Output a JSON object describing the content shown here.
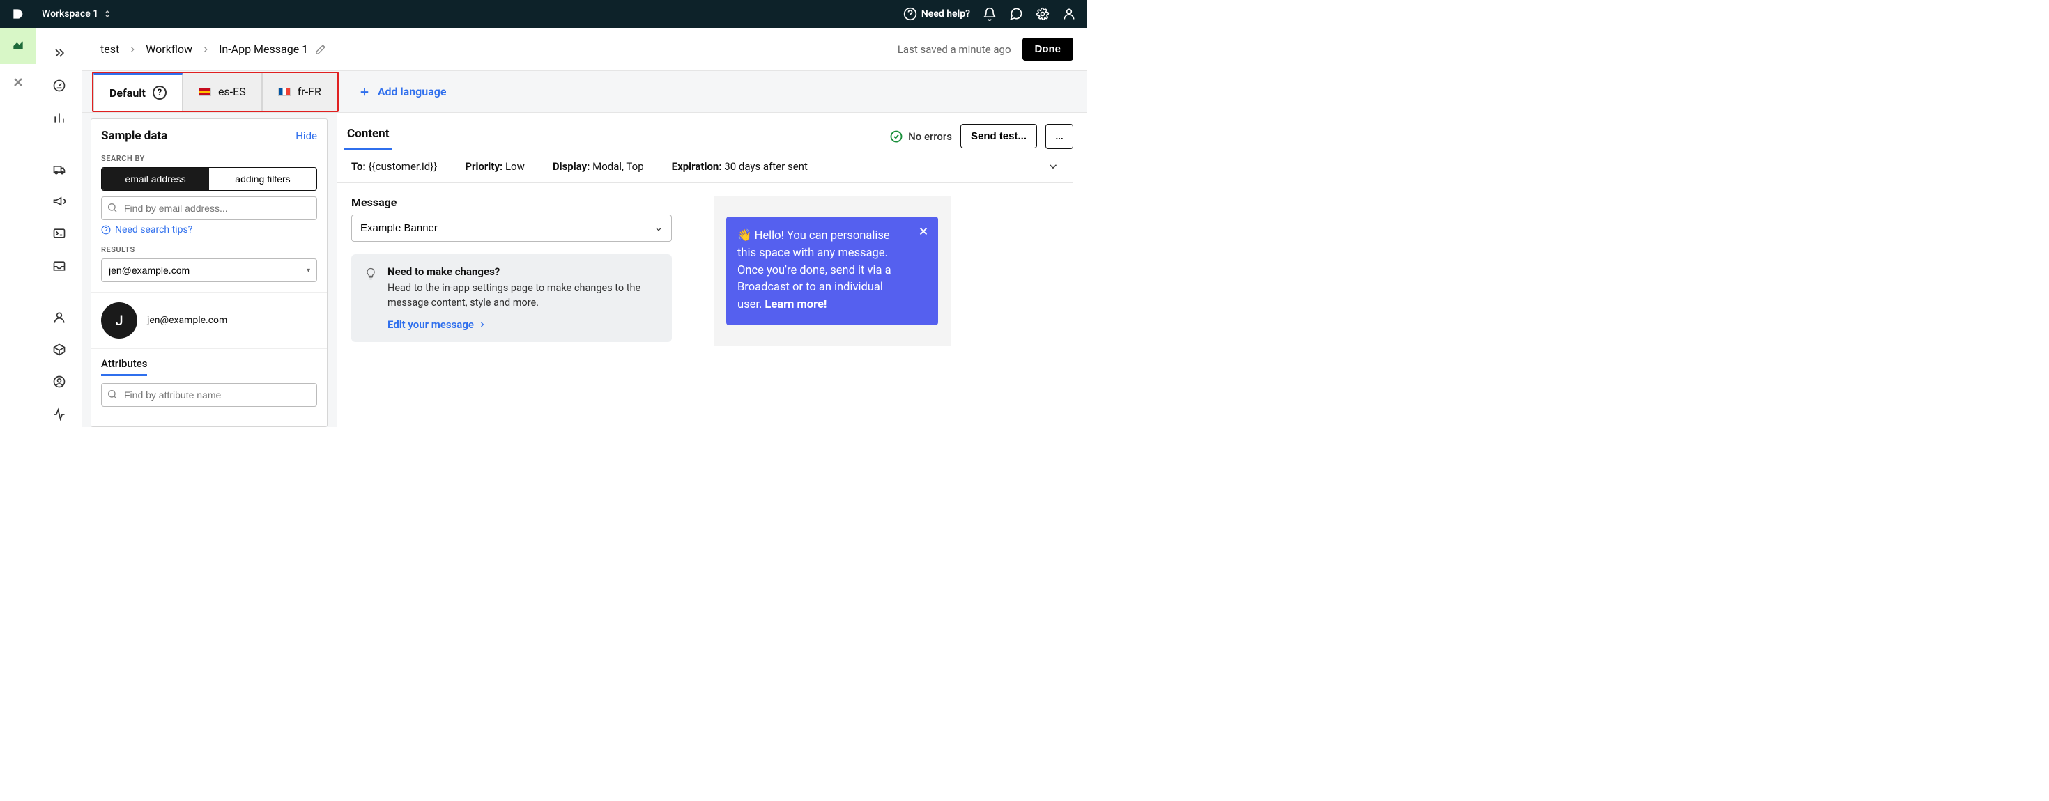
{
  "workspace_name": "Workspace 1",
  "topbar": {
    "help_label": "Need help?"
  },
  "breadcrumbs": {
    "items": [
      "test",
      "Workflow"
    ],
    "current": "In-App Message 1",
    "last_saved": "Last saved a minute ago",
    "done_label": "Done"
  },
  "language_tabs": {
    "tabs": [
      {
        "label": "Default",
        "active": true,
        "flag": null
      },
      {
        "label": "es-ES",
        "active": false,
        "flag": "es"
      },
      {
        "label": "fr-FR",
        "active": false,
        "flag": "fr"
      }
    ],
    "add_label": "Add language"
  },
  "sample_data": {
    "title": "Sample data",
    "hide_label": "Hide",
    "search_by_label": "SEARCH BY",
    "seg_email": "email address",
    "seg_filters": "adding filters",
    "search_placeholder": "Find by email address...",
    "tips_label": "Need search tips?",
    "results_label": "RESULTS",
    "selected_result": "jen@example.com",
    "avatar_initial": "J",
    "profile_email": "jen@example.com",
    "attr_tab_label": "Attributes",
    "attr_search_placeholder": "Find by attribute name"
  },
  "content": {
    "tab_label": "Content",
    "no_errors_label": "No errors",
    "send_test_label": "Send test...",
    "more_label": "...",
    "summary": {
      "to_label": "To:",
      "to_value": "{{customer.id}}",
      "priority_label": "Priority:",
      "priority_value": "Low",
      "display_label": "Display:",
      "display_value": "Modal, Top",
      "expiration_label": "Expiration:",
      "expiration_value": "30 days after sent"
    },
    "message_label": "Message",
    "message_select_value": "Example Banner",
    "hint": {
      "title": "Need to make changes?",
      "body": "Head to the in-app settings page to make changes to the message content, style and more.",
      "link": "Edit your message"
    },
    "preview_banner": {
      "emoji": "👋",
      "text_lead": "Hello! You can personalise this space with any message. Once you're done, send it via a Broadcast or to an individual user. ",
      "cta": "Learn more!"
    }
  }
}
